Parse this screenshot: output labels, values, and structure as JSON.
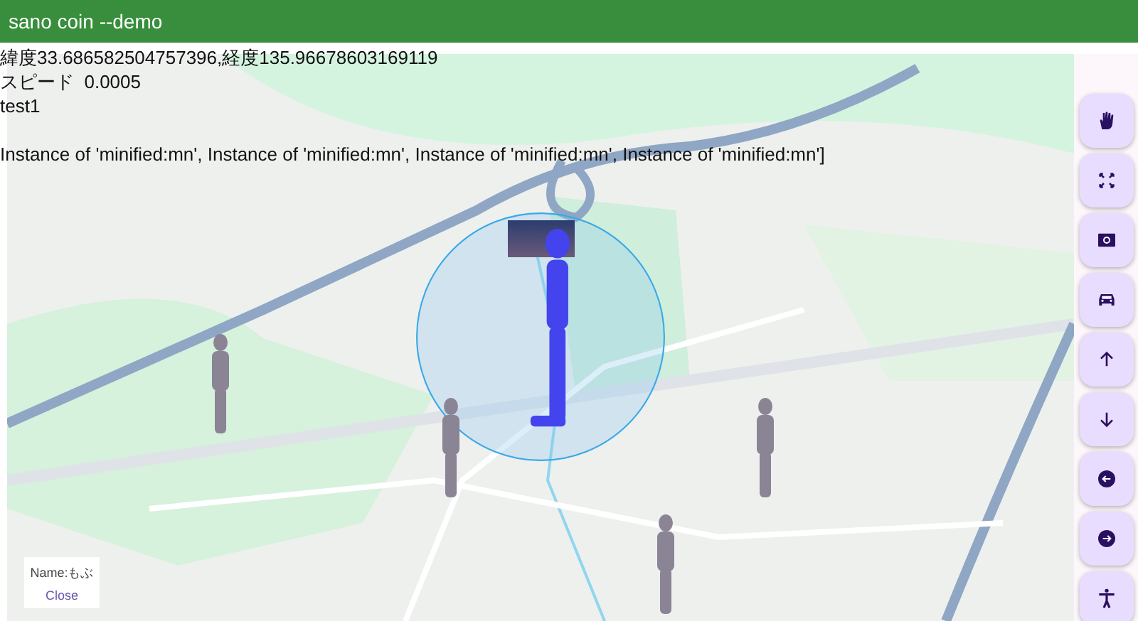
{
  "app_bar": {
    "title": "sano coin --demo"
  },
  "info_lines": [
    {
      "kind": "text",
      "text": "緯度33.686582504757396,経度135.96678603169119"
    },
    {
      "kind": "text",
      "text": "スピード  0.0005"
    },
    {
      "kind": "text",
      "text": "test1"
    },
    {
      "kind": "gap"
    },
    {
      "kind": "text",
      "text": "Instance of 'minified:mn', Instance of 'minified:mn', Instance of 'minified:mn', Instance of 'minified:mn']"
    }
  ],
  "info_popup": {
    "name": "Name:もぶ",
    "close": "Close"
  }
}
